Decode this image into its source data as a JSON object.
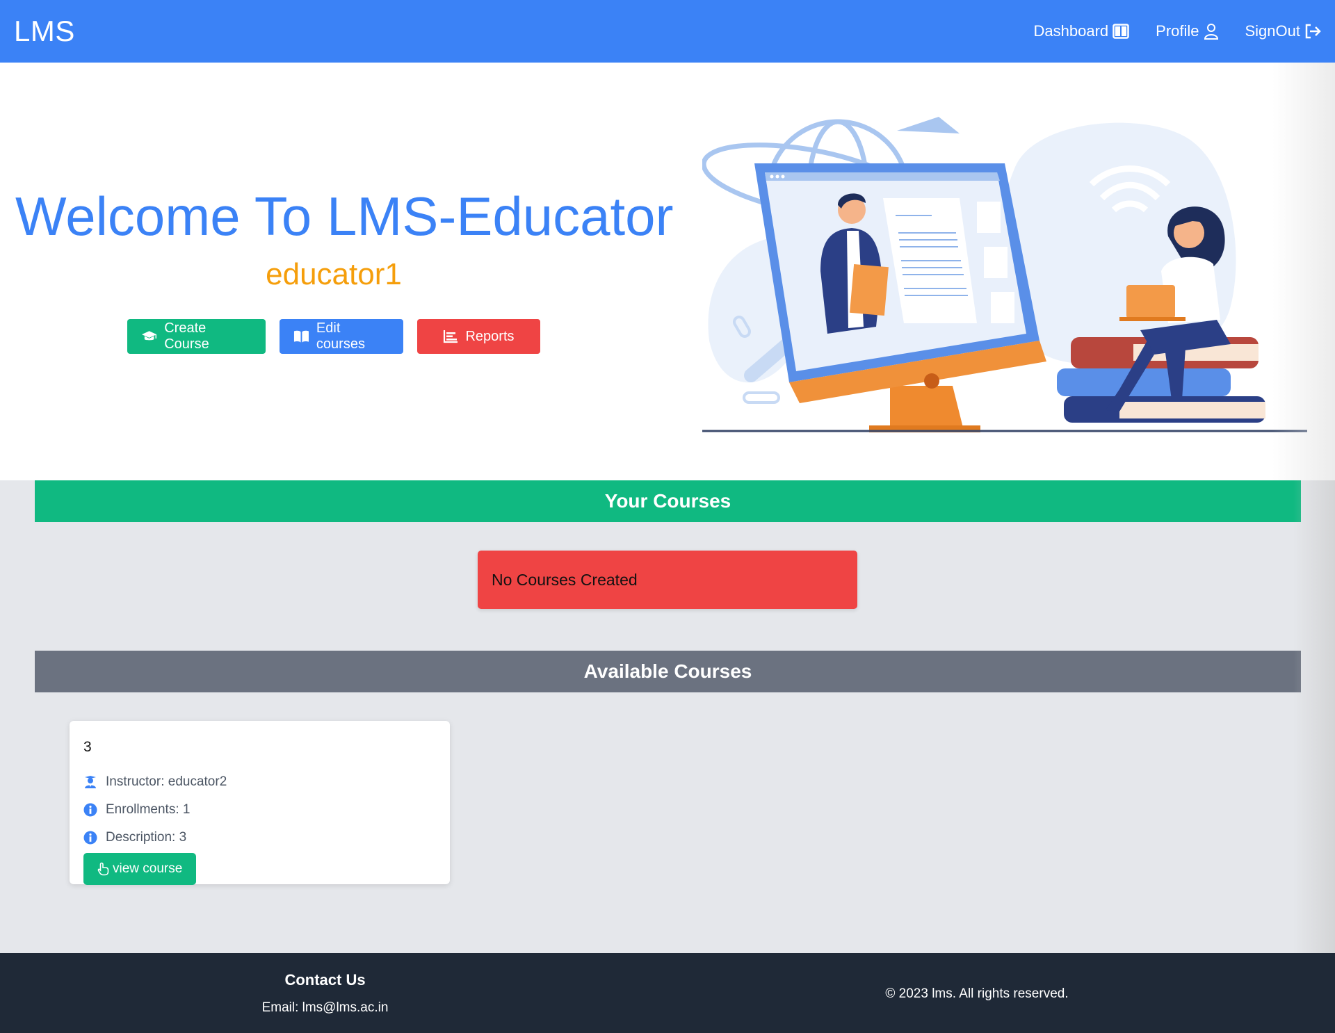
{
  "navbar": {
    "brand": "LMS",
    "links": [
      {
        "label": "Dashboard",
        "icon": "dashboard-icon"
      },
      {
        "label": "Profile",
        "icon": "user-icon"
      },
      {
        "label": "SignOut",
        "icon": "signout-icon"
      }
    ]
  },
  "hero": {
    "title": "Welcome To LMS-Educator",
    "username": "educator1",
    "buttons": {
      "create": "Create Course",
      "edit": "Edit courses",
      "reports": "Reports"
    }
  },
  "your_courses": {
    "title": "Your Courses",
    "empty_message": "No Courses Created"
  },
  "available_courses": {
    "title": "Available Courses",
    "courses": [
      {
        "name": "3",
        "instructor": "Instructor: educator2",
        "enrollments": "Enrollments: 1",
        "description": "Description: 3",
        "button": "view course"
      }
    ]
  },
  "footer": {
    "contact_title": "Contact Us",
    "email": "Email: lms@lms.ac.in",
    "copyright": "© 2023 lms. All rights reserved."
  },
  "colors": {
    "primary": "#3b82f6",
    "success": "#10b981",
    "danger": "#ef4444",
    "accent": "#f59e0b",
    "secondary": "#6b7280",
    "footer": "#1f2937"
  }
}
